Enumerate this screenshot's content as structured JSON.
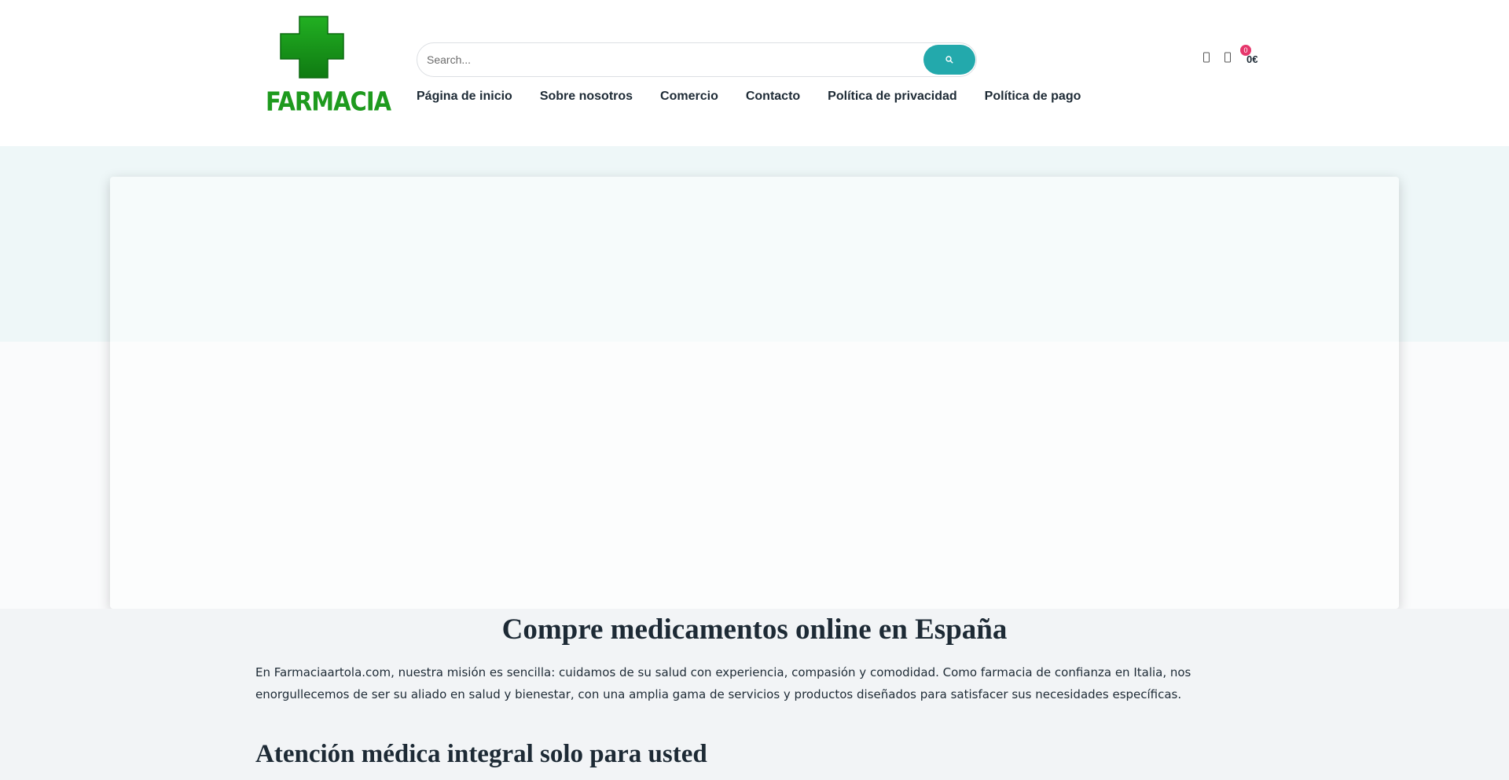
{
  "brand": {
    "logo_text": "FARMACIA",
    "cross_color": "#1e9a1e",
    "accent_color": "#23a9ac",
    "badge_color": "#e6376c"
  },
  "search": {
    "placeholder": "Search...",
    "button_icon": "search-icon"
  },
  "nav": {
    "items": [
      {
        "label": "Página de inicio"
      },
      {
        "label": "Sobre nosotros"
      },
      {
        "label": "Comercio"
      },
      {
        "label": "Contacto"
      },
      {
        "label": "Política de privacidad"
      },
      {
        "label": "Política de pago"
      }
    ]
  },
  "header_icons": {
    "account_icon": "user-icon",
    "cart_icon": "cart-icon",
    "cart_count": "0",
    "cart_total": "0€"
  },
  "main": {
    "title": "Compre medicamentos online en España",
    "intro": "En Farmaciaartola.com, nuestra misión es sencilla: cuidamos de su salud con experiencia, compasión y comodidad. Como farmacia de confianza en Italia, nos enorgullecemos de ser su aliado en salud y bienestar, con una amplia gama de servicios y productos diseñados para satisfacer sus necesidades específicas.",
    "section_title": "Atención médica integral solo para usted"
  }
}
